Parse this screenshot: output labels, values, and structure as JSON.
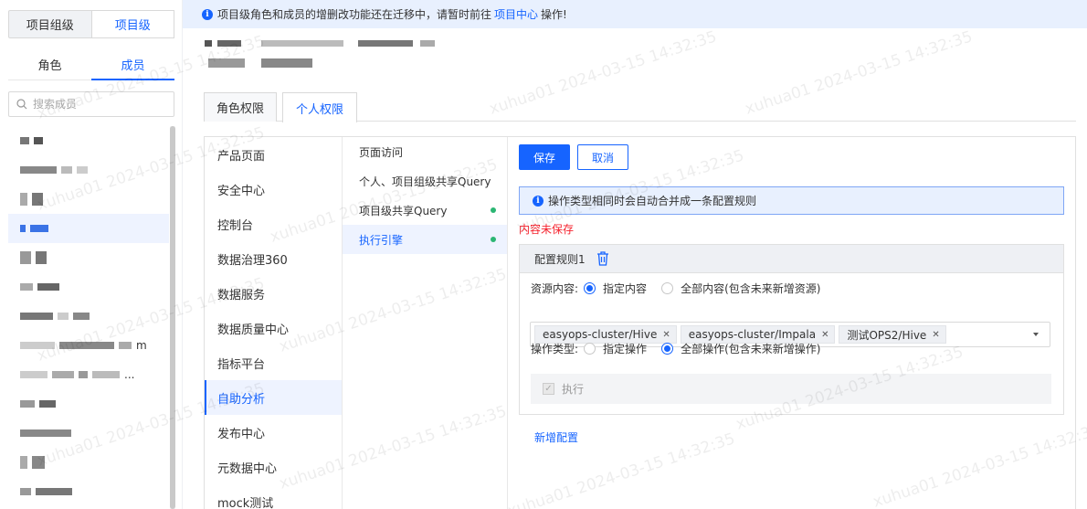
{
  "left": {
    "level_tabs": [
      "项目组级",
      "项目级"
    ],
    "sub_tabs": [
      "角色",
      "成员"
    ],
    "search_placeholder": "搜索成员",
    "members": [
      {
        "suffix": ""
      },
      {
        "suffix": ""
      },
      {
        "suffix": ""
      },
      {
        "suffix": ""
      },
      {
        "suffix": ""
      },
      {
        "suffix": ""
      },
      {
        "suffix": ""
      },
      {
        "suffix": "m"
      },
      {
        "suffix": "..."
      },
      {
        "suffix": ""
      },
      {
        "suffix": ""
      },
      {
        "suffix": ""
      },
      {
        "suffix": ""
      }
    ]
  },
  "notice": {
    "text_before": "项目级角色和成员的增删改功能还在迁移中，请暂时前往",
    "link": "项目中心",
    "text_after": "操作!"
  },
  "perm_tabs": [
    "角色权限",
    "个人权限"
  ],
  "col1": [
    "产品页面",
    "安全中心",
    "控制台",
    "数据治理360",
    "数据服务",
    "数据质量中心",
    "指标平台",
    "自助分析",
    "发布中心",
    "元数据中心",
    "mock测试"
  ],
  "col2": [
    {
      "label": "页面访问",
      "dot": false
    },
    {
      "label": "个人、项目组级共享Query",
      "dot": false
    },
    {
      "label": "项目级共享Query",
      "dot": true
    },
    {
      "label": "执行引擎",
      "dot": true
    }
  ],
  "editor": {
    "save": "保存",
    "cancel": "取消",
    "tip": "操作类型相同时会自动合并成一条配置规则",
    "unsaved": "内容未保存",
    "rule_title": "配置规则1",
    "resource_label": "资源内容:",
    "resource_opt1": "指定内容",
    "resource_opt2": "全部内容(包含未来新增资源)",
    "tags": [
      "easyops-cluster/Hive",
      "easyops-cluster/Impala",
      "测试OPS2/Hive"
    ],
    "op_label": "操作类型:",
    "op_opt1": "指定操作",
    "op_opt2": "全部操作(包含未来新增操作)",
    "op_check": "执行",
    "add_config": "新增配置"
  },
  "watermark": "xuhua01 2024-03-15 14:32:35",
  "colors": {
    "primary": "#1664ff",
    "danger": "#f5222d",
    "dot": "#2bb673"
  }
}
